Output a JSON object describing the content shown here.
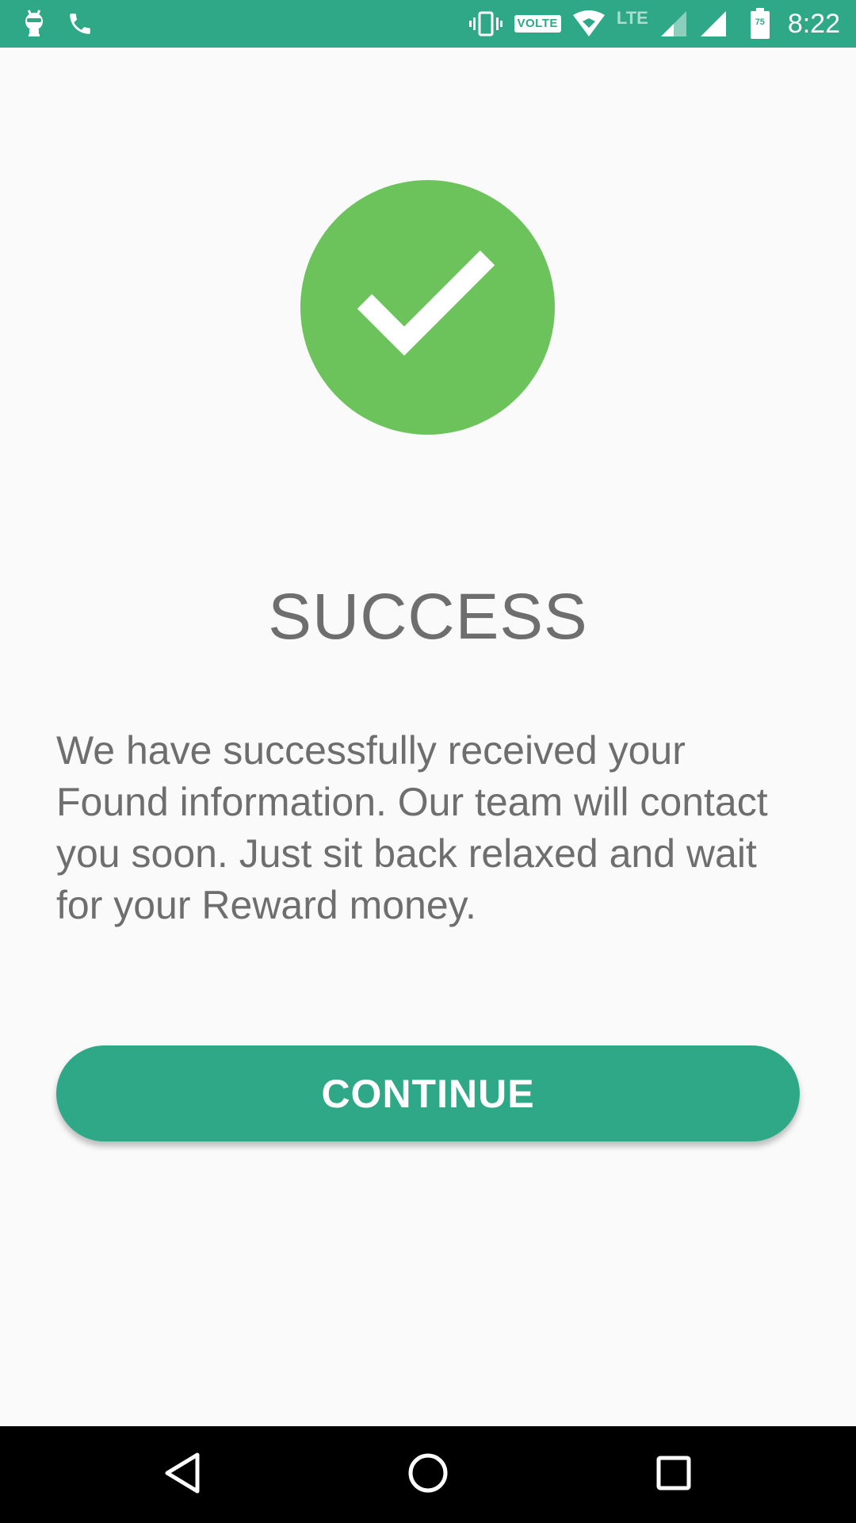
{
  "status_bar": {
    "time": "8:22",
    "volte": "VOLTE",
    "network": "LTE",
    "battery": "75",
    "icons": [
      "android-debug-icon",
      "phone-icon",
      "vibrate-icon",
      "volte-icon",
      "wifi-icon",
      "signal-icon",
      "signal-icon",
      "battery-icon"
    ]
  },
  "main": {
    "icon": "check-circle-icon",
    "title": "SUCCESS",
    "message": "We have successfully received your Found information. Our team will contact you soon. Just sit back relaxed and wait for your Reward money.",
    "continue_label": "CONTINUE"
  },
  "nav_bar": {
    "icons": [
      "back-icon",
      "home-icon",
      "recents-icon"
    ]
  },
  "colors": {
    "accent": "#2ea886",
    "success": "#6cc35c",
    "text": "#6e6e6e",
    "background": "#fafafa"
  }
}
